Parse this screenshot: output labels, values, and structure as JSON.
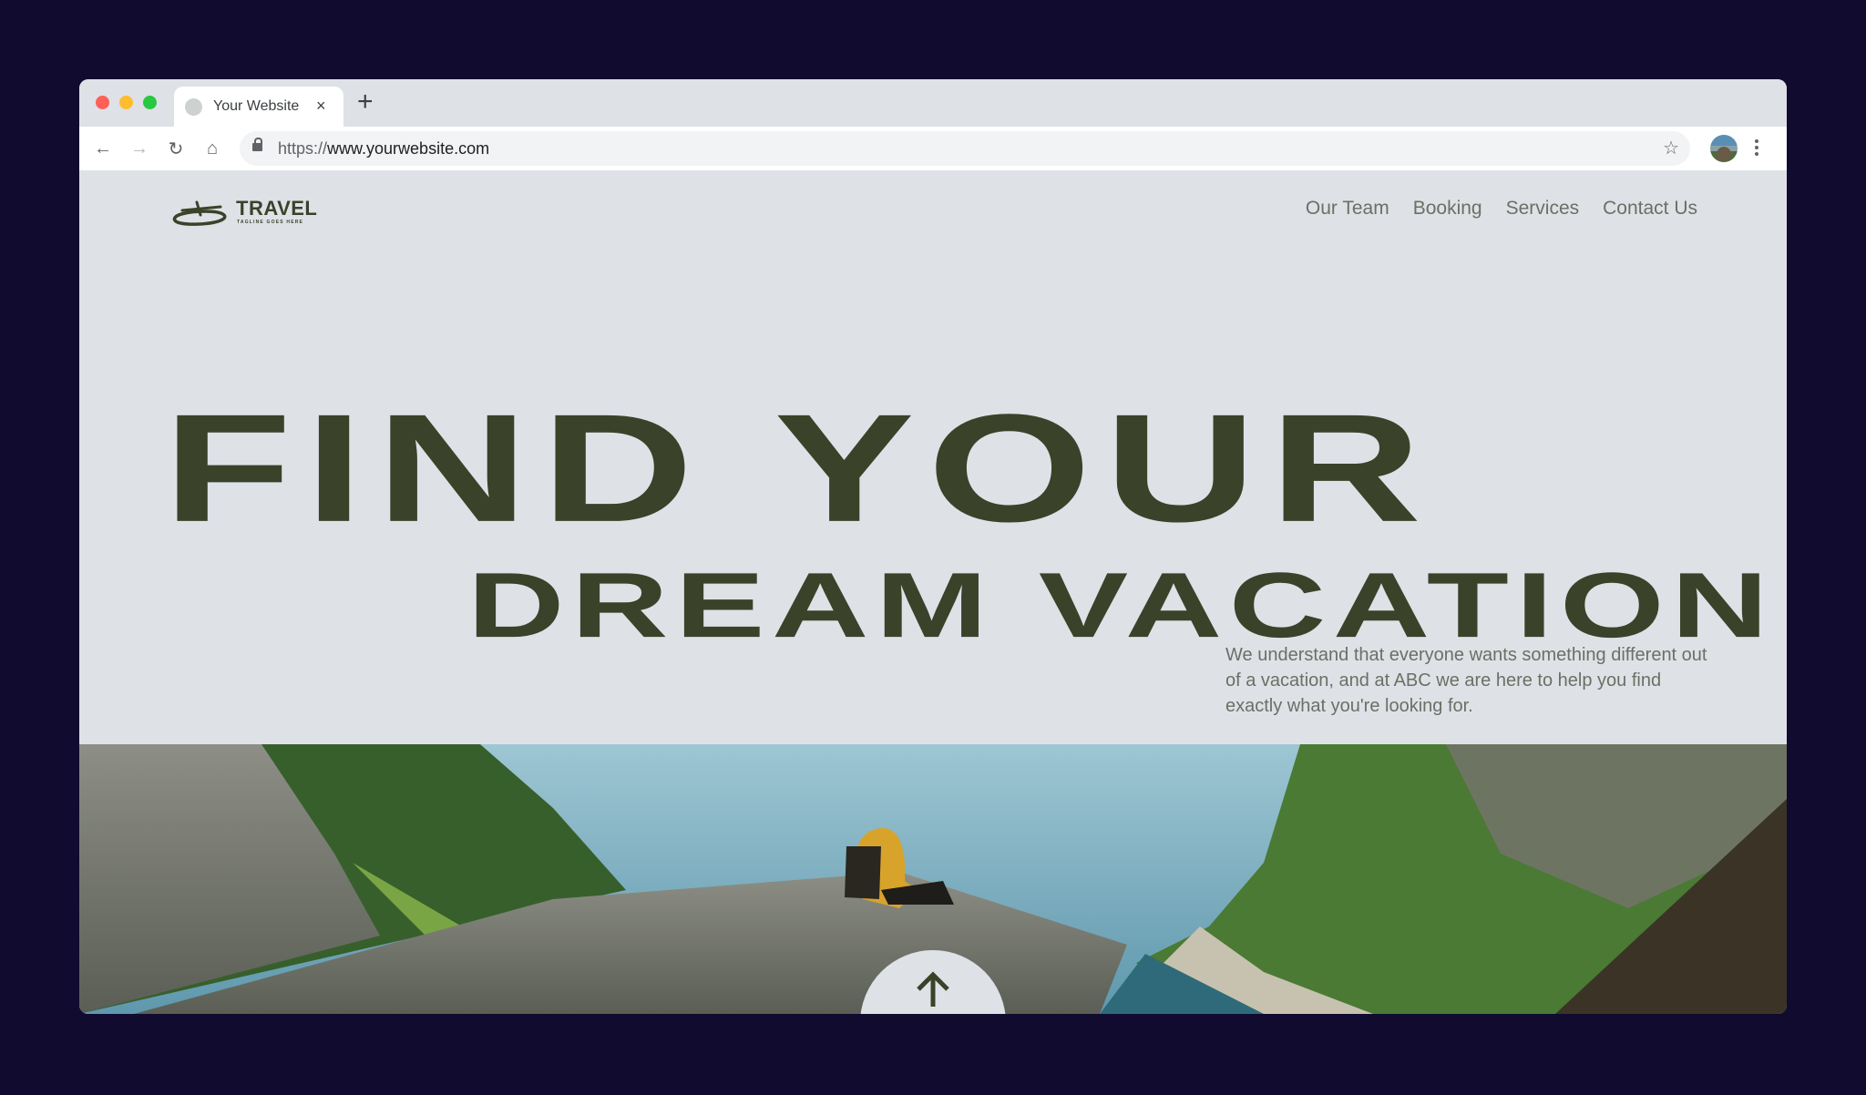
{
  "browser": {
    "tab_title": "Your Website",
    "tab_close": "×",
    "new_tab": "+",
    "url_scheme": "https://",
    "url_host": "www.yourwebsite.com",
    "icons": {
      "back": "←",
      "forward": "→",
      "reload": "↻",
      "home": "⌂",
      "star": "☆"
    }
  },
  "site": {
    "logo": {
      "name": "TRAVEL",
      "tagline": "TAGLINE GOES HERE"
    },
    "nav": [
      "Our Team",
      "Booking",
      "Services",
      "Contact Us"
    ],
    "hero": {
      "line1": "FIND YOUR",
      "line2": "DREAM VACATION"
    },
    "intro": "We understand that everyone wants something different out of a vacation, and at ABC we are here to help you find exactly what you're looking for.",
    "image_alt": "Hiker in yellow jacket sitting on a cliff edge above a fjord",
    "colors": {
      "brand": "#3a4229",
      "background": "#dee2e7",
      "text_muted": "#6c6f65"
    }
  }
}
